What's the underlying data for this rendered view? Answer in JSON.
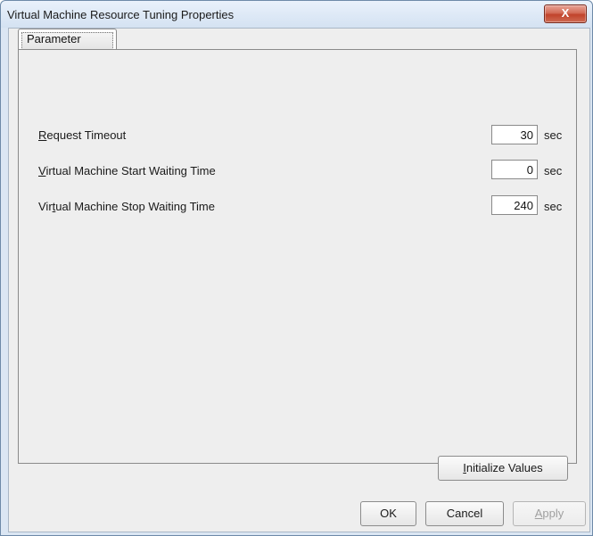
{
  "window": {
    "title": "Virtual Machine Resource Tuning Properties",
    "close_label": "X"
  },
  "tabs": [
    {
      "label": "Parameter",
      "selected": true
    }
  ],
  "fields": [
    {
      "label_mnemonic": "R",
      "label_rest": "equest Timeout",
      "value": "30",
      "unit": "sec"
    },
    {
      "label_mnemonic": "V",
      "label_rest": "irtual Machine Start Waiting Time",
      "value": "0",
      "unit": "sec"
    },
    {
      "label_before": "Vir",
      "label_mnemonic": "t",
      "label_rest": "ual Machine Stop Waiting Time",
      "value": "240",
      "unit": "sec"
    }
  ],
  "buttons": {
    "initialize": {
      "mnemonic": "I",
      "rest": "nitialize Values"
    },
    "ok": "OK",
    "cancel": "Cancel",
    "apply": {
      "mnemonic": "A",
      "rest": "pply",
      "enabled": false
    }
  }
}
